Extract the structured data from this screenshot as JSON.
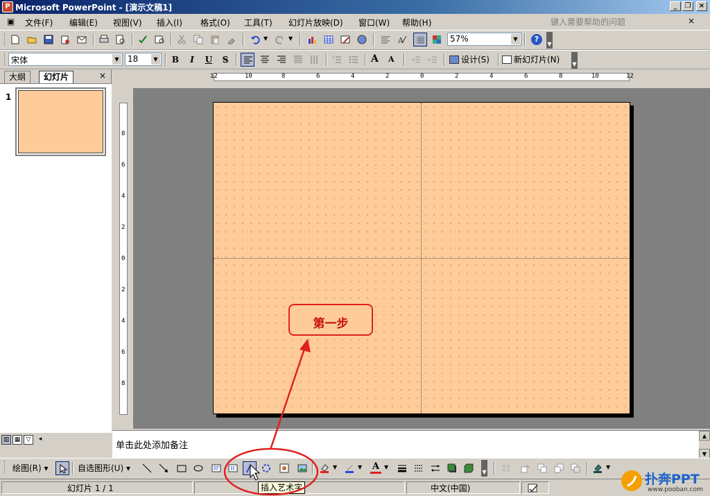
{
  "window": {
    "title": "Microsoft PowerPoint - [演示文稿1]",
    "icon_text": "P"
  },
  "menu": {
    "items": [
      "文件(F)",
      "编辑(E)",
      "视图(V)",
      "插入(I)",
      "格式(O)",
      "工具(T)",
      "幻灯片放映(D)",
      "窗口(W)",
      "帮助(H)"
    ],
    "help_placeholder": "键入需要帮助的问题",
    "close_glyph": "×"
  },
  "standard_toolbar": {
    "zoom_value": "57%",
    "help_icon": "?"
  },
  "formatting_toolbar": {
    "font_name": "宋体",
    "font_size": "18",
    "bold": "B",
    "italic": "I",
    "underline": "U",
    "shadow": "S",
    "design_label": "设计(S)",
    "new_slide_label": "新幻灯片(N)"
  },
  "left_pane": {
    "tab_outline": "大纲",
    "tab_slides": "幻灯片",
    "close_glyph": "×",
    "slide_number": "1"
  },
  "ruler": {
    "top_ticks": [
      "12",
      "10",
      "8",
      "6",
      "4",
      "2",
      "0",
      "2",
      "4",
      "6",
      "8",
      "10",
      "12"
    ],
    "left_ticks": [
      "8",
      "6",
      "4",
      "2",
      "0",
      "2",
      "4",
      "6",
      "8"
    ]
  },
  "slide": {
    "background_color": "#ffcc99"
  },
  "callout": {
    "text": "第一步",
    "color": "#e02020"
  },
  "notes": {
    "placeholder": "单击此处添加备注"
  },
  "drawing_toolbar": {
    "draw_label": "绘图(R)",
    "autoshapes_label": "自选图形(U)"
  },
  "tooltip": {
    "text": "插入艺术字"
  },
  "status": {
    "slide_info": "幻灯片 1 / 1",
    "language": "中文(中国)"
  },
  "watermark": {
    "brand": "扑奔PPT",
    "url": "www.pooban.com"
  }
}
